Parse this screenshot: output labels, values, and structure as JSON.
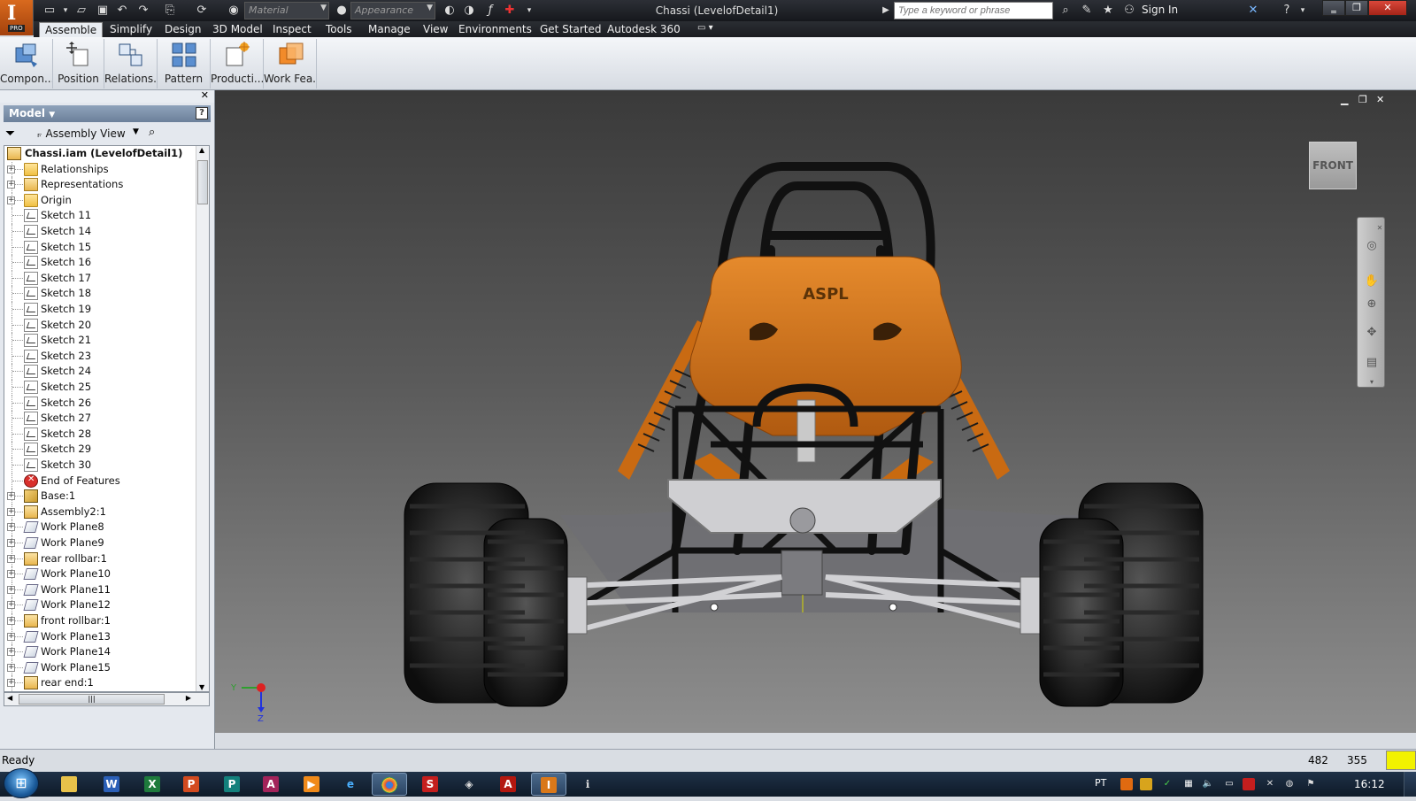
{
  "titlebar": {
    "window_title": "Chassi (LevelofDetail1)",
    "app_logo_letter": "I",
    "app_logo_badge": "PRO",
    "material_combo": "Material",
    "appearance_combo": "Appearance",
    "search_placeholder": "Type a keyword or phrase",
    "sign_in": "Sign In"
  },
  "ribbon_tabs": [
    "Assemble",
    "Simplify",
    "Design",
    "3D Model",
    "Inspect",
    "Tools",
    "Manage",
    "View",
    "Environments",
    "Get Started",
    "Autodesk 360"
  ],
  "ribbon_buttons": [
    "Compon...",
    "Position",
    "Relations...",
    "Pattern",
    "Producti...",
    "Work Fea..."
  ],
  "browser": {
    "header": "Model",
    "view_label": "Assembly View",
    "tree": [
      {
        "label": "Chassi.iam (LevelofDetail1)",
        "icon": "assembly-icon",
        "expander": "−"
      },
      {
        "label": "Relationships",
        "icon": "folder-icon",
        "expander": "+"
      },
      {
        "label": "Representations",
        "icon": "representations-icon",
        "expander": "+"
      },
      {
        "label": "Origin",
        "icon": "folder-icon",
        "expander": "+"
      },
      {
        "label": "Sketch 11",
        "icon": "sketch-icon",
        "expander": ""
      },
      {
        "label": "Sketch 14",
        "icon": "sketch-icon",
        "expander": ""
      },
      {
        "label": "Sketch 15",
        "icon": "sketch-icon",
        "expander": ""
      },
      {
        "label": "Sketch 16",
        "icon": "sketch-icon",
        "expander": ""
      },
      {
        "label": "Sketch 17",
        "icon": "sketch-icon",
        "expander": ""
      },
      {
        "label": "Sketch 18",
        "icon": "sketch-icon",
        "expander": ""
      },
      {
        "label": "Sketch 19",
        "icon": "sketch-icon",
        "expander": ""
      },
      {
        "label": "Sketch 20",
        "icon": "sketch-icon",
        "expander": ""
      },
      {
        "label": "Sketch 21",
        "icon": "sketch-icon",
        "expander": ""
      },
      {
        "label": "Sketch 23",
        "icon": "sketch-icon",
        "expander": ""
      },
      {
        "label": "Sketch 24",
        "icon": "sketch-icon",
        "expander": ""
      },
      {
        "label": "Sketch 25",
        "icon": "sketch-icon",
        "expander": ""
      },
      {
        "label": "Sketch 26",
        "icon": "sketch-icon",
        "expander": ""
      },
      {
        "label": "Sketch 27",
        "icon": "sketch-icon",
        "expander": ""
      },
      {
        "label": "Sketch 28",
        "icon": "sketch-icon",
        "expander": ""
      },
      {
        "label": "Sketch 29",
        "icon": "sketch-icon",
        "expander": ""
      },
      {
        "label": "Sketch 30",
        "icon": "sketch-icon",
        "expander": ""
      },
      {
        "label": "End of Features",
        "icon": "end-of-features-icon",
        "expander": ""
      },
      {
        "label": "Base:1",
        "icon": "part-icon",
        "expander": "+"
      },
      {
        "label": "Assembly2:1",
        "icon": "subassembly-icon",
        "expander": "+"
      },
      {
        "label": "Work Plane8",
        "icon": "work-plane-icon",
        "expander": "+"
      },
      {
        "label": "Work Plane9",
        "icon": "work-plane-icon",
        "expander": "+"
      },
      {
        "label": "rear rollbar:1",
        "icon": "subassembly-icon",
        "expander": "+"
      },
      {
        "label": "Work Plane10",
        "icon": "work-plane-icon",
        "expander": "+"
      },
      {
        "label": "Work Plane11",
        "icon": "work-plane-icon",
        "expander": "+"
      },
      {
        "label": "Work Plane12",
        "icon": "work-plane-icon",
        "expander": "+"
      },
      {
        "label": "front rollbar:1",
        "icon": "subassembly-icon",
        "expander": "+"
      },
      {
        "label": "Work Plane13",
        "icon": "work-plane-icon",
        "expander": "+"
      },
      {
        "label": "Work Plane14",
        "icon": "work-plane-icon",
        "expander": "+"
      },
      {
        "label": "Work Plane15",
        "icon": "work-plane-icon",
        "expander": "+"
      },
      {
        "label": "rear end:1",
        "icon": "subassembly-icon",
        "expander": "+"
      }
    ]
  },
  "viewport": {
    "viewcube_face": "FRONT",
    "seat_logo": "ASPL",
    "triad_y": "Y",
    "triad_z": "Z"
  },
  "status": {
    "text": "Ready",
    "x": "482",
    "y": "355"
  },
  "taskbar": {
    "language": "PT",
    "clock": "16:12",
    "apps": [
      "W",
      "X",
      "P",
      "P",
      "A",
      "A",
      "I"
    ]
  },
  "colors": {
    "accent_orange": "#d9781a",
    "ribbon_active_tab": "#e8ecf1",
    "viewport_top": "#3a3a3a",
    "viewport_bottom": "#8e8e8e"
  }
}
